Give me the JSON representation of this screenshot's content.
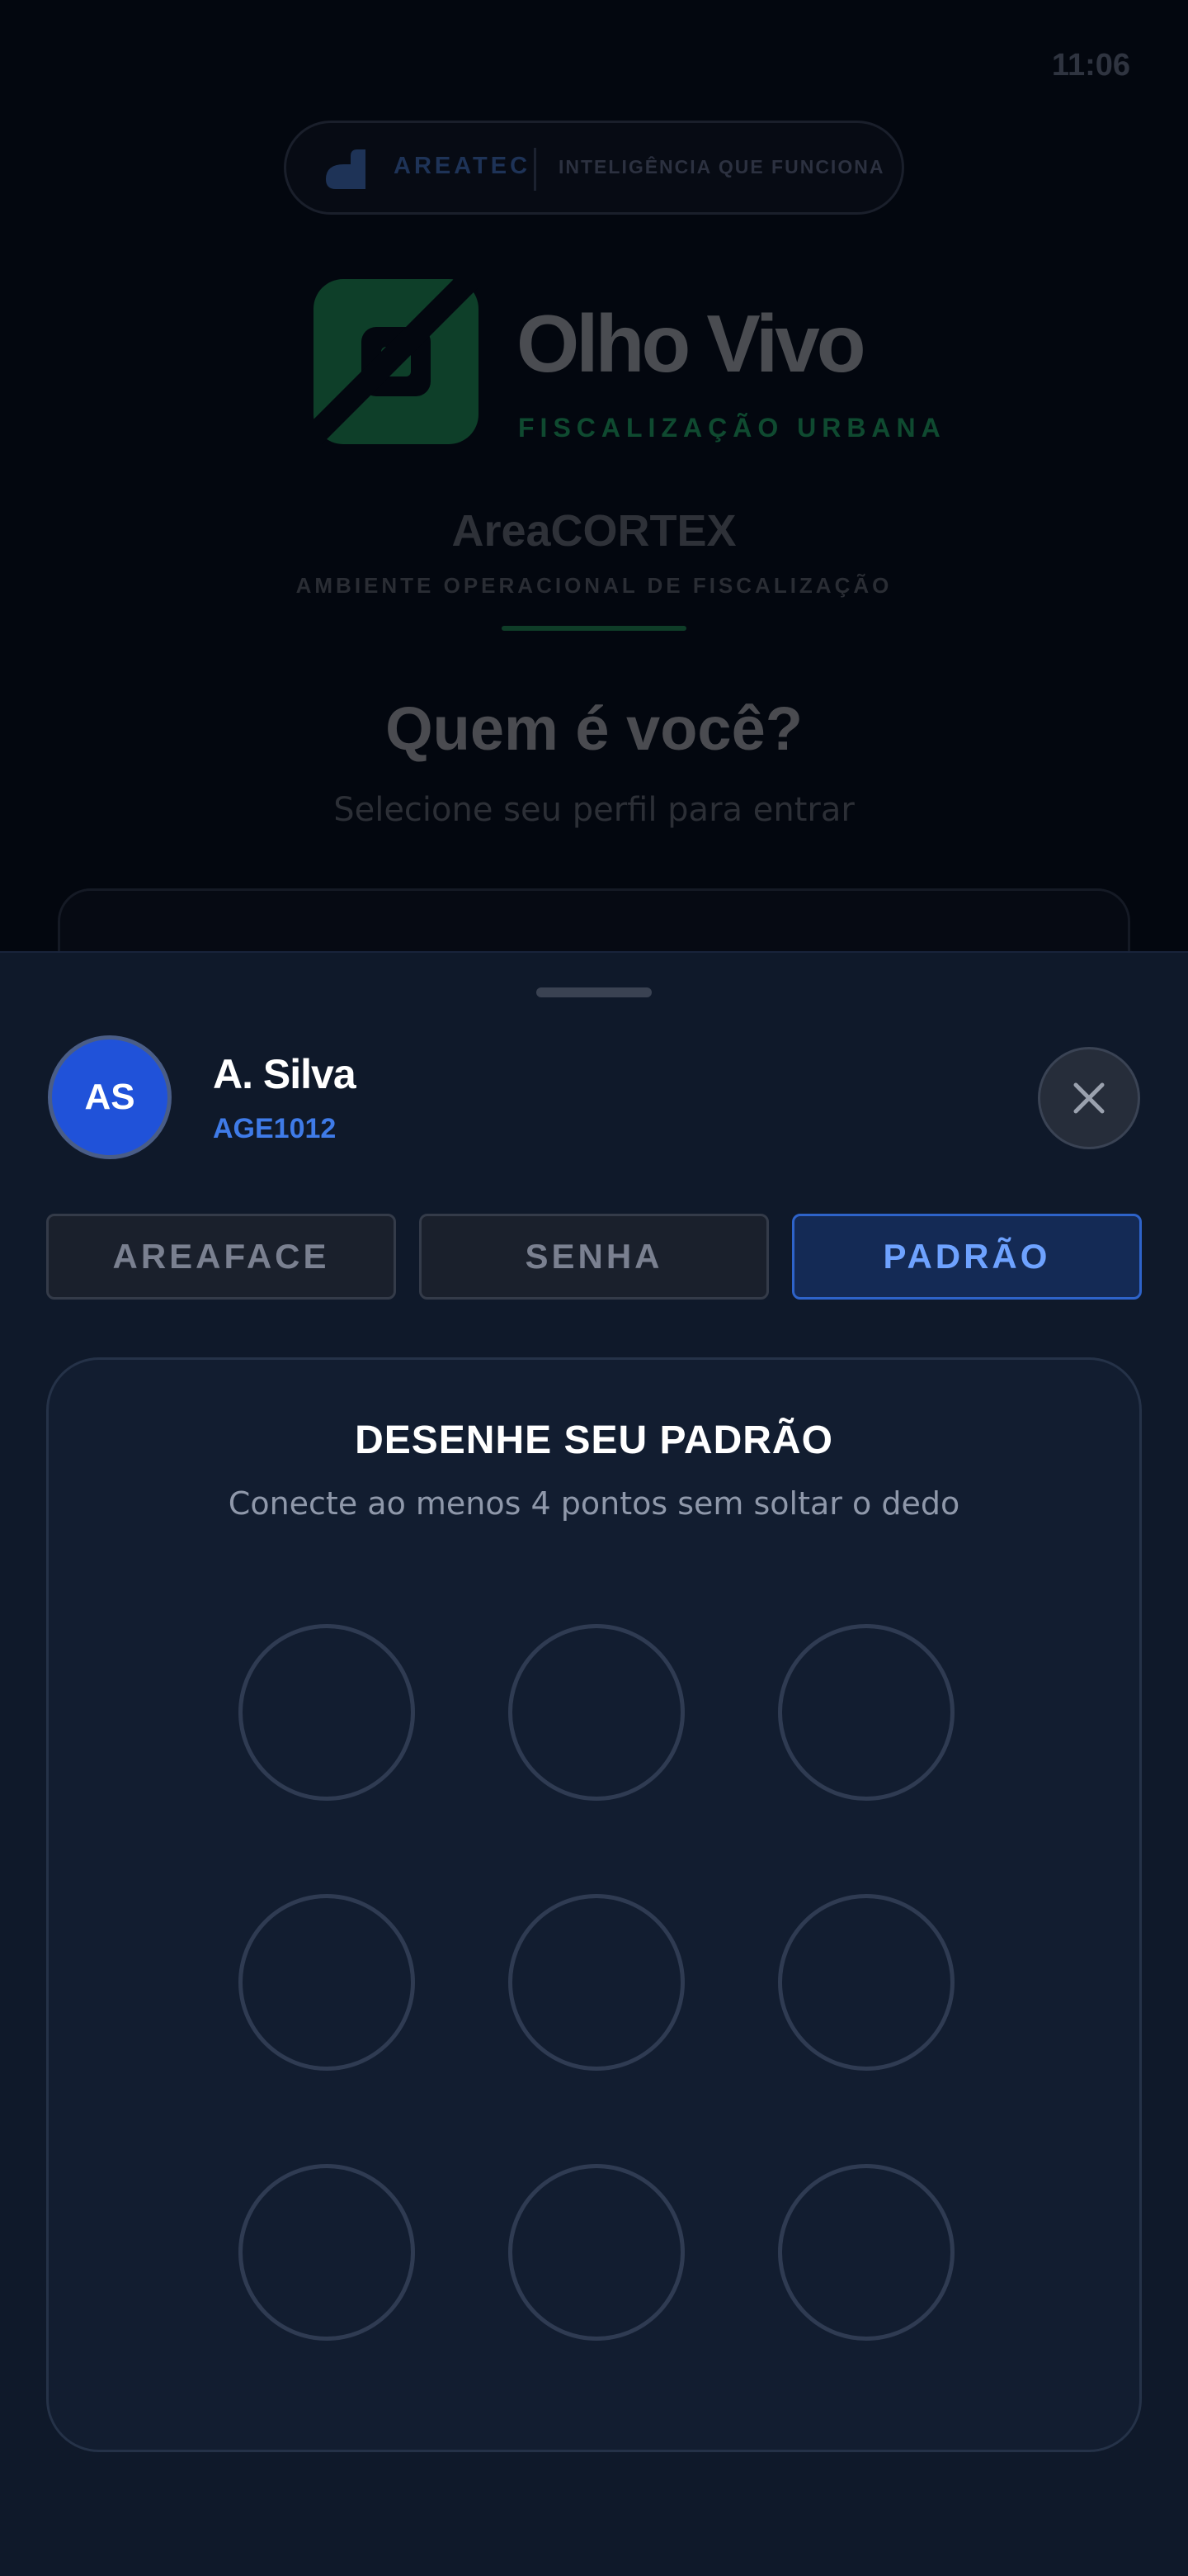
{
  "status_bar": {
    "time": "11:06"
  },
  "brand": {
    "name": "AREATEC",
    "tagline": "INTELIGÊNCIA QUE FUNCIONA",
    "icon": "areatec-logo-icon"
  },
  "logo": {
    "name": "Olho Vivo",
    "subtitle": "FISCALIZAÇÃO URBANA",
    "icon": "olho-vivo-logo-icon"
  },
  "app": {
    "title": "AreaCORTEX",
    "subtitle": "AMBIENTE OPERACIONAL DE FISCALIZAÇÃO"
  },
  "login": {
    "title": "Quem é você?",
    "subtitle": "Selecione seu perfil para entrar"
  },
  "sheet": {
    "user": {
      "initials": "AS",
      "name": "A. Silva",
      "code": "AGE1012"
    },
    "close_icon": "close-icon",
    "tabs": [
      {
        "label": "AREAFACE",
        "active": false
      },
      {
        "label": "SENHA",
        "active": false
      },
      {
        "label": "PADRÃO",
        "active": true
      }
    ],
    "pattern": {
      "title": "DESENHE SEU PADRÃO",
      "hint": "Conecte ao menos 4 pontos sem soltar o dedo",
      "dots_selected": []
    }
  },
  "colors": {
    "accent_blue": "#2052d9",
    "active_tab_text": "#6ea2ff",
    "brand_green": "#0f4a30",
    "sheet_bg": "#0f192a"
  }
}
